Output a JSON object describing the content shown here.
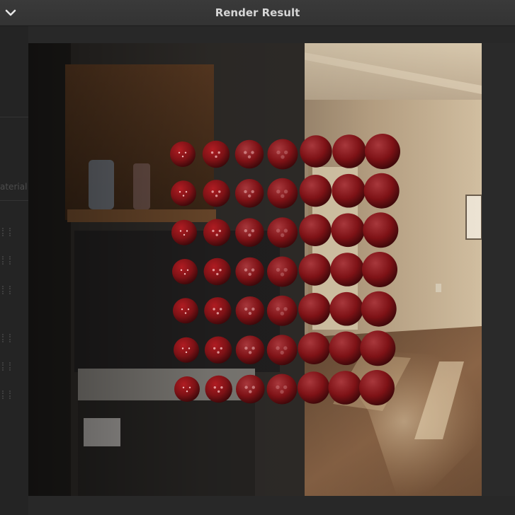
{
  "window": {
    "title": "Render Result",
    "collapse_icon": "chevron-down-icon"
  },
  "background_panel": {
    "partial_label": "aterial"
  },
  "render": {
    "scene": "room-interior",
    "sphere_grid": {
      "columns": 7,
      "rows": 7
    },
    "colors": {
      "sphere": "#8a1418",
      "wall_dark": "#2c2a27",
      "wall_light": "#b49a7a",
      "floor": "#7a5a3e",
      "ceiling": "#c9b79c"
    }
  }
}
